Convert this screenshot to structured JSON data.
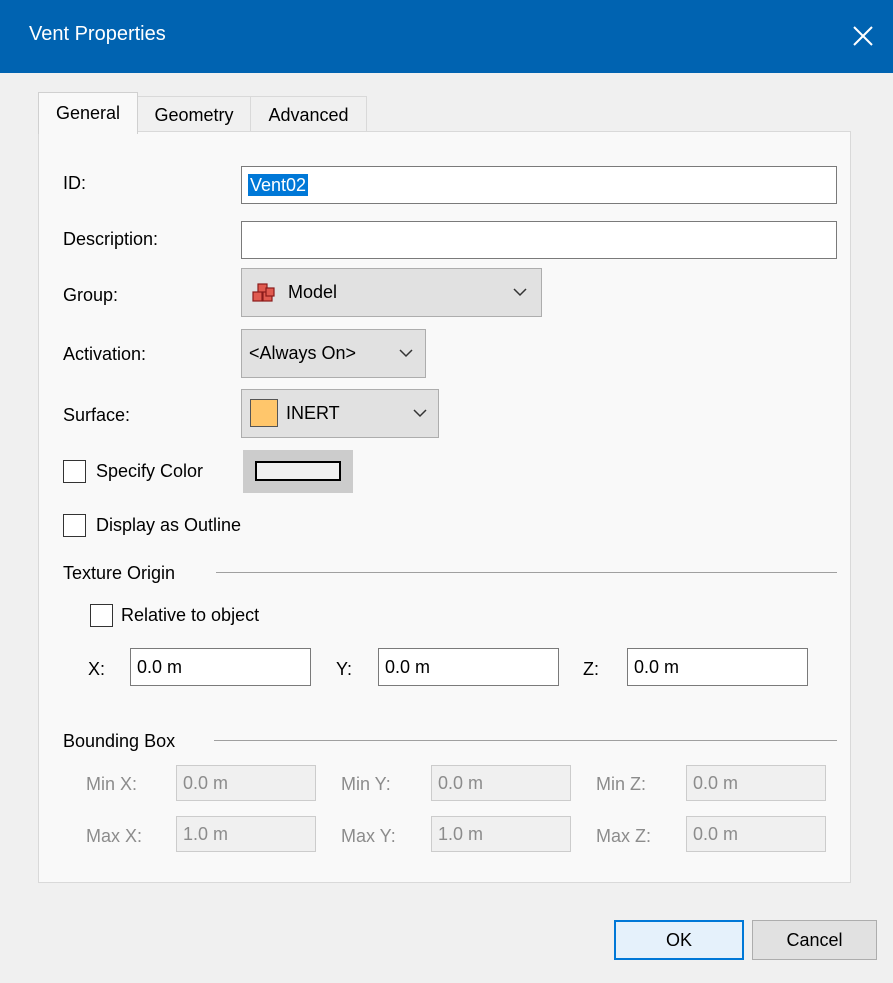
{
  "window": {
    "title": "Vent Properties"
  },
  "tabs": [
    {
      "label": "General"
    },
    {
      "label": "Geometry"
    },
    {
      "label": "Advanced"
    }
  ],
  "general": {
    "id_label": "ID:",
    "id_value": "Vent02",
    "description_label": "Description:",
    "description_value": "",
    "group_label": "Group:",
    "group_value": "Model",
    "activation_label": "Activation:",
    "activation_value": "<Always On>",
    "surface_label": "Surface:",
    "surface_value": "INERT",
    "surface_color": "#ffc66b",
    "specify_color_label": "Specify Color",
    "specify_color_checked": false,
    "display_outline_label": "Display as Outline",
    "display_outline_checked": false
  },
  "texture_origin": {
    "group_label": "Texture Origin",
    "relative_label": "Relative to object",
    "relative_checked": false,
    "x_label": "X:",
    "x_value": "0.0 m",
    "y_label": "Y:",
    "y_value": "0.0 m",
    "z_label": "Z:",
    "z_value": "0.0 m"
  },
  "bounding_box": {
    "group_label": "Bounding Box",
    "min_x_label": "Min X:",
    "min_x_value": "0.0 m",
    "min_y_label": "Min Y:",
    "min_y_value": "0.0 m",
    "min_z_label": "Min Z:",
    "min_z_value": "0.0 m",
    "max_x_label": "Max X:",
    "max_x_value": "1.0 m",
    "max_y_label": "Max Y:",
    "max_y_value": "1.0 m",
    "max_z_label": "Max Z:",
    "max_z_value": "0.0 m"
  },
  "buttons": {
    "ok": "OK",
    "cancel": "Cancel"
  },
  "colors": {
    "titlebar": "#0063b1",
    "selection": "#0078d7",
    "model_icon": "#c0392b"
  }
}
